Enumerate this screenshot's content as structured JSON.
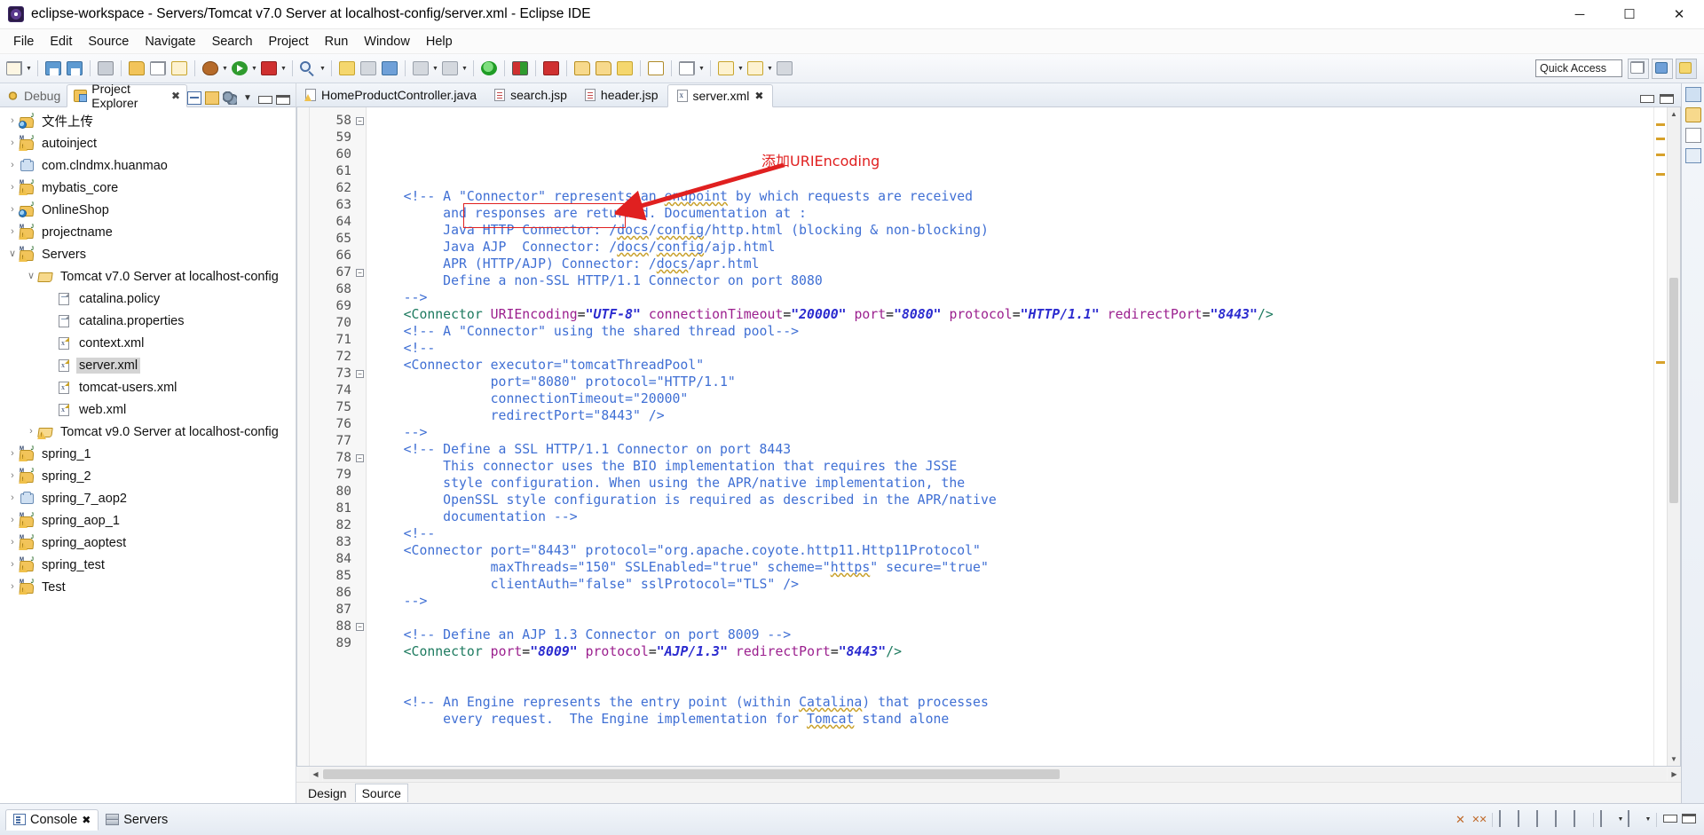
{
  "window": {
    "title": "eclipse-workspace - Servers/Tomcat v7.0 Server at localhost-config/server.xml - Eclipse IDE",
    "icon": "eclipse-icon",
    "minimize": "─",
    "maximize": "☐",
    "close": "✕"
  },
  "menu": {
    "items": [
      {
        "label": "File"
      },
      {
        "label": "Edit"
      },
      {
        "label": "Source"
      },
      {
        "label": "Navigate"
      },
      {
        "label": "Search"
      },
      {
        "label": "Project"
      },
      {
        "label": "Run"
      },
      {
        "label": "Window"
      },
      {
        "label": "Help"
      }
    ]
  },
  "toolbar": {
    "quick_access_label": "Quick Access"
  },
  "left_panel": {
    "tabs": [
      {
        "label": "Debug",
        "icon": "debug-icon",
        "active": false
      },
      {
        "label": "Project Explorer",
        "icon": "project-explorer-icon",
        "active": true,
        "close": "✖"
      }
    ],
    "tree": [
      {
        "label": "文件上传",
        "indent": 0,
        "arrow": "›",
        "icon": "java-web-project-icon",
        "selected": false
      },
      {
        "label": "autoinject",
        "indent": 0,
        "arrow": "›",
        "icon": "maven-project-icon",
        "selected": false
      },
      {
        "label": "com.clndmx.huanmao",
        "indent": 0,
        "arrow": "›",
        "icon": "plain-project-icon",
        "selected": false
      },
      {
        "label": "mybatis_core",
        "indent": 0,
        "arrow": "›",
        "icon": "maven-project-icon",
        "selected": false
      },
      {
        "label": "OnlineShop",
        "indent": 0,
        "arrow": "›",
        "icon": "java-web-project-icon",
        "selected": false
      },
      {
        "label": "projectname",
        "indent": 0,
        "arrow": "›",
        "icon": "maven-project-icon",
        "selected": false
      },
      {
        "label": "Servers",
        "indent": 0,
        "arrow": "∨",
        "icon": "maven-project-icon",
        "selected": false
      },
      {
        "label": "Tomcat v7.0 Server at localhost-config",
        "indent": 1,
        "arrow": "∨",
        "icon": "open-folder-icon",
        "selected": false
      },
      {
        "label": "catalina.policy",
        "indent": 2,
        "arrow": "",
        "icon": "file-icon",
        "selected": false
      },
      {
        "label": "catalina.properties",
        "indent": 2,
        "arrow": "",
        "icon": "file-icon",
        "selected": false
      },
      {
        "label": "context.xml",
        "indent": 2,
        "arrow": "",
        "icon": "xml-file-icon",
        "selected": false
      },
      {
        "label": "server.xml",
        "indent": 2,
        "arrow": "",
        "icon": "xml-file-icon",
        "selected": true
      },
      {
        "label": "tomcat-users.xml",
        "indent": 2,
        "arrow": "",
        "icon": "xml-file-icon",
        "selected": false
      },
      {
        "label": "web.xml",
        "indent": 2,
        "arrow": "",
        "icon": "xml-file-icon",
        "selected": false
      },
      {
        "label": "Tomcat v9.0 Server at localhost-config",
        "indent": 1,
        "arrow": "›",
        "icon": "open-folder-warn-icon",
        "selected": false
      },
      {
        "label": "spring_1",
        "indent": 0,
        "arrow": "›",
        "icon": "maven-project-icon",
        "selected": false
      },
      {
        "label": "spring_2",
        "indent": 0,
        "arrow": "›",
        "icon": "maven-project-icon",
        "selected": false
      },
      {
        "label": "spring_7_aop2",
        "indent": 0,
        "arrow": "›",
        "icon": "plain-project-icon",
        "selected": false
      },
      {
        "label": "spring_aop_1",
        "indent": 0,
        "arrow": "›",
        "icon": "maven-project-icon",
        "selected": false
      },
      {
        "label": "spring_aoptest",
        "indent": 0,
        "arrow": "›",
        "icon": "maven-project-icon",
        "selected": false
      },
      {
        "label": "spring_test",
        "indent": 0,
        "arrow": "›",
        "icon": "maven-project-icon",
        "selected": false
      },
      {
        "label": "Test",
        "indent": 0,
        "arrow": "›",
        "icon": "maven-project-icon",
        "selected": false
      }
    ]
  },
  "editor": {
    "tabs": [
      {
        "label": "HomeProductController.java",
        "icon": "java-file-icon",
        "active": false
      },
      {
        "label": "search.jsp",
        "icon": "jsp-file-icon",
        "active": false
      },
      {
        "label": "header.jsp",
        "icon": "jsp-file-icon",
        "active": false
      },
      {
        "label": "server.xml",
        "icon": "xml-file-icon",
        "active": true,
        "close": "✖"
      }
    ],
    "first_line_number": 58,
    "lines": [
      {
        "n": 58,
        "fold": "⊖",
        "segments": [
          {
            "t": "    ",
            "c": "plain"
          },
          {
            "t": "<!-- A \"Connector\" represents an ",
            "c": "comment"
          },
          {
            "t": "endpoint",
            "c": "comment spell"
          },
          {
            "t": " by which requests are received",
            "c": "comment"
          }
        ]
      },
      {
        "n": 59,
        "fold": "",
        "segments": [
          {
            "t": "         and responses are returned. Documentation at :",
            "c": "comment"
          }
        ]
      },
      {
        "n": 60,
        "fold": "",
        "segments": [
          {
            "t": "         Java HTTP Connector: /",
            "c": "comment"
          },
          {
            "t": "docs",
            "c": "comment spell"
          },
          {
            "t": "/",
            "c": "comment"
          },
          {
            "t": "config",
            "c": "comment spell"
          },
          {
            "t": "/http.html (blocking & non-blocking)",
            "c": "comment"
          }
        ]
      },
      {
        "n": 61,
        "fold": "",
        "segments": [
          {
            "t": "         Java AJP  Connector: /",
            "c": "comment"
          },
          {
            "t": "docs",
            "c": "comment spell"
          },
          {
            "t": "/",
            "c": "comment"
          },
          {
            "t": "config",
            "c": "comment spell"
          },
          {
            "t": "/ajp.html",
            "c": "comment"
          }
        ]
      },
      {
        "n": 62,
        "fold": "",
        "segments": [
          {
            "t": "         APR (HTTP/AJP) Connector: /",
            "c": "comment"
          },
          {
            "t": "docs",
            "c": "comment spell"
          },
          {
            "t": "/apr.html",
            "c": "comment"
          }
        ]
      },
      {
        "n": 63,
        "fold": "",
        "segments": [
          {
            "t": "         Define a non-SSL HTTP/1.1 Connector on port 8080",
            "c": "comment"
          }
        ]
      },
      {
        "n": 64,
        "fold": "",
        "segments": [
          {
            "t": "    -->",
            "c": "comment"
          }
        ]
      },
      {
        "n": 65,
        "fold": "",
        "segments": [
          {
            "t": "    ",
            "c": "plain"
          },
          {
            "t": "<Connector",
            "c": "tag"
          },
          {
            "t": " ",
            "c": "plain"
          },
          {
            "t": "URIEncoding",
            "c": "attr"
          },
          {
            "t": "=",
            "c": "punc"
          },
          {
            "t": "\"UTF-8\"",
            "c": "val"
          },
          {
            "t": " ",
            "c": "plain"
          },
          {
            "t": "connectionTimeout",
            "c": "attr"
          },
          {
            "t": "=",
            "c": "punc"
          },
          {
            "t": "\"20000\"",
            "c": "val"
          },
          {
            "t": " ",
            "c": "plain"
          },
          {
            "t": "port",
            "c": "attr"
          },
          {
            "t": "=",
            "c": "punc"
          },
          {
            "t": "\"8080\"",
            "c": "val"
          },
          {
            "t": " ",
            "c": "plain"
          },
          {
            "t": "protocol",
            "c": "attr"
          },
          {
            "t": "=",
            "c": "punc"
          },
          {
            "t": "\"HTTP/1.1\"",
            "c": "val"
          },
          {
            "t": " ",
            "c": "plain"
          },
          {
            "t": "redirectPort",
            "c": "attr"
          },
          {
            "t": "=",
            "c": "punc"
          },
          {
            "t": "\"8443\"",
            "c": "val"
          },
          {
            "t": "/>",
            "c": "tag"
          }
        ]
      },
      {
        "n": 66,
        "fold": "",
        "segments": [
          {
            "t": "    <!-- A \"Connector\" using the shared thread pool-->",
            "c": "comment"
          }
        ]
      },
      {
        "n": 67,
        "fold": "⊖",
        "segments": [
          {
            "t": "    <!--",
            "c": "comment"
          }
        ]
      },
      {
        "n": 68,
        "fold": "",
        "segments": [
          {
            "t": "    <Connector executor=\"tomcatThreadPool\"",
            "c": "comment"
          }
        ]
      },
      {
        "n": 69,
        "fold": "",
        "segments": [
          {
            "t": "               port=\"8080\" protocol=\"HTTP/1.1\"",
            "c": "comment"
          }
        ]
      },
      {
        "n": 70,
        "fold": "",
        "segments": [
          {
            "t": "               connectionTimeout=\"20000\"",
            "c": "comment"
          }
        ]
      },
      {
        "n": 71,
        "fold": "",
        "segments": [
          {
            "t": "               redirectPort=\"8443\" />",
            "c": "comment"
          }
        ]
      },
      {
        "n": 72,
        "fold": "",
        "segments": [
          {
            "t": "    -->",
            "c": "comment"
          }
        ]
      },
      {
        "n": 73,
        "fold": "⊖",
        "segments": [
          {
            "t": "    <!-- Define a SSL HTTP/1.1 Connector on port 8443",
            "c": "comment"
          }
        ]
      },
      {
        "n": 74,
        "fold": "",
        "segments": [
          {
            "t": "         This connector uses the BIO implementation that requires the JSSE",
            "c": "comment"
          }
        ]
      },
      {
        "n": 75,
        "fold": "",
        "segments": [
          {
            "t": "         style configuration. When using the APR/native implementation, the",
            "c": "comment"
          }
        ]
      },
      {
        "n": 76,
        "fold": "",
        "segments": [
          {
            "t": "         OpenSSL style configuration is required as described in the APR/native",
            "c": "comment"
          }
        ]
      },
      {
        "n": 77,
        "fold": "",
        "segments": [
          {
            "t": "         documentation -->",
            "c": "comment"
          }
        ]
      },
      {
        "n": 78,
        "fold": "⊖",
        "segments": [
          {
            "t": "    <!--",
            "c": "comment"
          }
        ]
      },
      {
        "n": 79,
        "fold": "",
        "segments": [
          {
            "t": "    <Connector port=\"8443\" protocol=\"org.apache.coyote.http11.Http11Protocol\"",
            "c": "comment"
          }
        ]
      },
      {
        "n": 80,
        "fold": "",
        "segments": [
          {
            "t": "               maxThreads=\"150\" SSLEnabled=\"true\" scheme=\"",
            "c": "comment"
          },
          {
            "t": "https",
            "c": "comment spell"
          },
          {
            "t": "\" secure=\"true\"",
            "c": "comment"
          }
        ]
      },
      {
        "n": 81,
        "fold": "",
        "segments": [
          {
            "t": "               clientAuth=\"false\" sslProtocol=\"TLS\" />",
            "c": "comment"
          }
        ]
      },
      {
        "n": 82,
        "fold": "",
        "segments": [
          {
            "t": "    -->",
            "c": "comment"
          }
        ]
      },
      {
        "n": 83,
        "fold": "",
        "segments": [
          {
            "t": "",
            "c": "plain"
          }
        ]
      },
      {
        "n": 84,
        "fold": "",
        "segments": [
          {
            "t": "    <!-- Define an AJP 1.3 Connector on port 8009 -->",
            "c": "comment"
          }
        ]
      },
      {
        "n": 85,
        "fold": "",
        "segments": [
          {
            "t": "    ",
            "c": "plain"
          },
          {
            "t": "<Connector",
            "c": "tag"
          },
          {
            "t": " ",
            "c": "plain"
          },
          {
            "t": "port",
            "c": "attr"
          },
          {
            "t": "=",
            "c": "punc"
          },
          {
            "t": "\"8009\"",
            "c": "val"
          },
          {
            "t": " ",
            "c": "plain"
          },
          {
            "t": "protocol",
            "c": "attr"
          },
          {
            "t": "=",
            "c": "punc"
          },
          {
            "t": "\"AJP/1.3\"",
            "c": "val"
          },
          {
            "t": " ",
            "c": "plain"
          },
          {
            "t": "redirectPort",
            "c": "attr"
          },
          {
            "t": "=",
            "c": "punc"
          },
          {
            "t": "\"8443\"",
            "c": "val"
          },
          {
            "t": "/>",
            "c": "tag"
          }
        ]
      },
      {
        "n": 86,
        "fold": "",
        "segments": [
          {
            "t": "",
            "c": "plain"
          }
        ]
      },
      {
        "n": 87,
        "fold": "",
        "segments": [
          {
            "t": "",
            "c": "plain"
          }
        ]
      },
      {
        "n": 88,
        "fold": "⊖",
        "segments": [
          {
            "t": "    <!-- An Engine represents the entry point (within ",
            "c": "comment"
          },
          {
            "t": "Catalina",
            "c": "comment spell"
          },
          {
            "t": ") that processes",
            "c": "comment"
          }
        ]
      },
      {
        "n": 89,
        "fold": "",
        "segments": [
          {
            "t": "         every request.  The Engine implementation for ",
            "c": "comment"
          },
          {
            "t": "Tomcat",
            "c": "comment spell"
          },
          {
            "t": " stand alone",
            "c": "comment"
          }
        ]
      }
    ],
    "annotation": {
      "text": "添加URIEncoding",
      "color": "#e02020"
    },
    "bottom_tabs": [
      {
        "label": "Design",
        "active": false
      },
      {
        "label": "Source",
        "active": true
      }
    ]
  },
  "bottom_panel": {
    "tabs": [
      {
        "label": "Console",
        "icon": "console-icon",
        "active": true,
        "close": "✖"
      },
      {
        "label": "Servers",
        "icon": "servers-icon",
        "active": false
      }
    ]
  }
}
